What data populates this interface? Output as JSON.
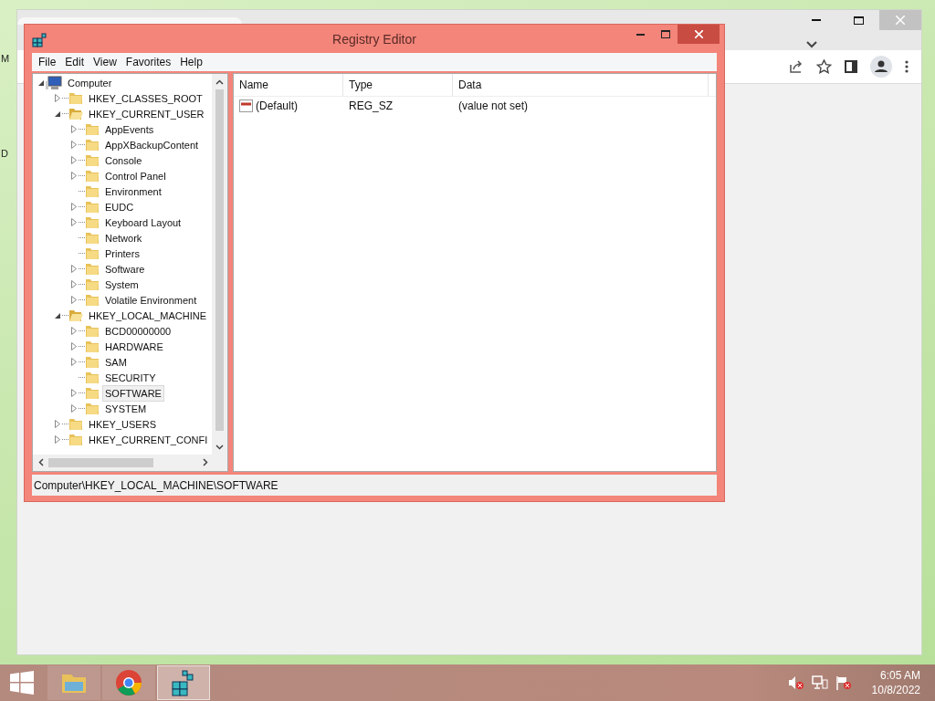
{
  "desktop": {
    "edge_labels": [
      "M",
      "D"
    ]
  },
  "registry_editor": {
    "title": "Registry Editor",
    "menu": [
      "File",
      "Edit",
      "View",
      "Favorites",
      "Help"
    ],
    "tree": [
      {
        "label": "Computer",
        "kind": "branch",
        "expanded": true,
        "selected": false,
        "children": [
          {
            "label": "HKEY_CLASSES_ROOT",
            "kind": "branch",
            "expanded": false,
            "selected": false
          },
          {
            "label": "HKEY_CURRENT_USER",
            "kind": "branch",
            "expanded": true,
            "selected": false,
            "children": [
              {
                "label": "AppEvents",
                "kind": "branch",
                "expanded": false,
                "selected": false
              },
              {
                "label": "AppXBackupContent",
                "kind": "branch",
                "expanded": false,
                "selected": false
              },
              {
                "label": "Console",
                "kind": "branch",
                "expanded": false,
                "selected": false
              },
              {
                "label": "Control Panel",
                "kind": "branch",
                "expanded": false,
                "selected": false
              },
              {
                "label": "Environment",
                "kind": "leaf",
                "selected": false
              },
              {
                "label": "EUDC",
                "kind": "branch",
                "expanded": false,
                "selected": false
              },
              {
                "label": "Keyboard Layout",
                "kind": "branch",
                "expanded": false,
                "selected": false
              },
              {
                "label": "Network",
                "kind": "leaf",
                "selected": false
              },
              {
                "label": "Printers",
                "kind": "leaf",
                "selected": false
              },
              {
                "label": "Software",
                "kind": "branch",
                "expanded": false,
                "selected": false
              },
              {
                "label": "System",
                "kind": "branch",
                "expanded": false,
                "selected": false
              },
              {
                "label": "Volatile Environment",
                "kind": "branch",
                "expanded": false,
                "selected": false
              }
            ]
          },
          {
            "label": "HKEY_LOCAL_MACHINE",
            "kind": "branch",
            "expanded": true,
            "selected": false,
            "children": [
              {
                "label": "BCD00000000",
                "kind": "branch",
                "expanded": false,
                "selected": false
              },
              {
                "label": "HARDWARE",
                "kind": "branch",
                "expanded": false,
                "selected": false
              },
              {
                "label": "SAM",
                "kind": "branch",
                "expanded": false,
                "selected": false
              },
              {
                "label": "SECURITY",
                "kind": "leaf",
                "selected": false
              },
              {
                "label": "SOFTWARE",
                "kind": "branch",
                "expanded": false,
                "selected": true
              },
              {
                "label": "SYSTEM",
                "kind": "branch",
                "expanded": false,
                "selected": false
              }
            ]
          },
          {
            "label": "HKEY_USERS",
            "kind": "branch",
            "expanded": false,
            "selected": false
          },
          {
            "label": "HKEY_CURRENT_CONFI",
            "kind": "branch",
            "expanded": false,
            "selected": false
          }
        ]
      }
    ],
    "columns": [
      "Name",
      "Type",
      "Data"
    ],
    "values": [
      {
        "name": "(Default)",
        "type": "REG_SZ",
        "data": "(value not set)"
      }
    ],
    "status": "Computer\\HKEY_LOCAL_MACHINE\\SOFTWARE"
  },
  "taskbar": {
    "apps": [
      {
        "kind": "explorer",
        "active": false
      },
      {
        "kind": "chrome",
        "active": false
      },
      {
        "kind": "regedit",
        "active": true
      }
    ],
    "time": "6:05 AM",
    "date": "10/8/2022"
  }
}
